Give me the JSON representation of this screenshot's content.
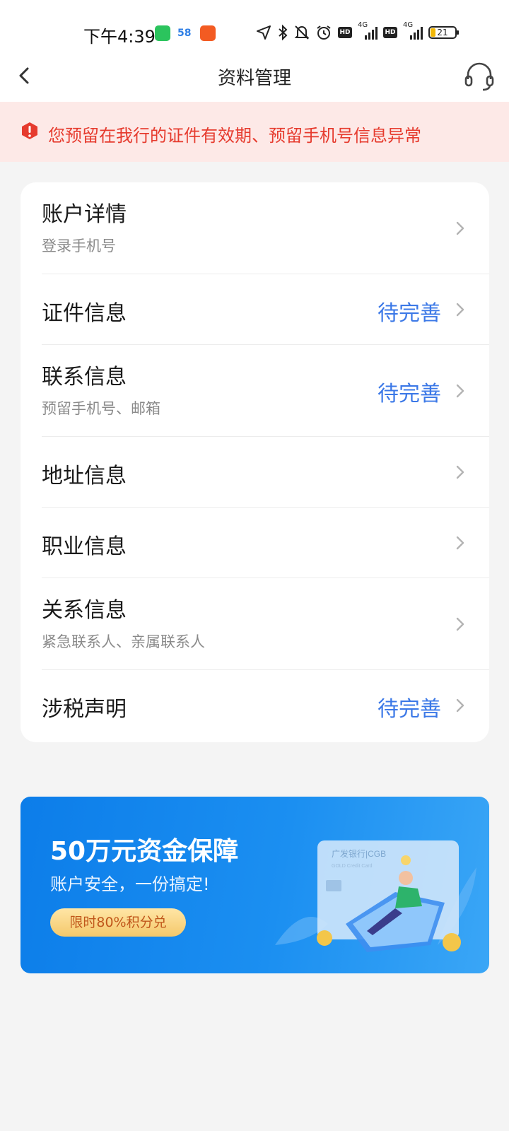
{
  "status_bar": {
    "time": "下午4:39",
    "net1": "4G",
    "net2": "4G",
    "hd": "HD",
    "battery": "21",
    "app_58": "58"
  },
  "nav": {
    "title": "资料管理",
    "back_icon": "chevron-left-icon",
    "support_icon": "headset-icon"
  },
  "alert": {
    "text": "您预留在我行的证件有效期、预留手机号信息异常",
    "icon": "exclamation-shield-icon",
    "color": "#e63b2e",
    "bg": "#fde9e7"
  },
  "profile_items": [
    {
      "title": "账户详情",
      "subtitle": "登录手机号",
      "status": ""
    },
    {
      "title": "证件信息",
      "subtitle": "",
      "status": "待完善"
    },
    {
      "title": "联系信息",
      "subtitle": "预留手机号、邮箱",
      "status": "待完善"
    },
    {
      "title": "地址信息",
      "subtitle": "",
      "status": ""
    },
    {
      "title": "职业信息",
      "subtitle": "",
      "status": ""
    },
    {
      "title": "关系信息",
      "subtitle": "紧急联系人、亲属联系人",
      "status": ""
    },
    {
      "title": "涉税声明",
      "subtitle": "",
      "status": "待完善"
    }
  ],
  "status_color": "#3b78e7",
  "banner": {
    "title": "50万元资金保障",
    "subtitle": "账户安全，一份搞定!",
    "button": "限时80%积分兑",
    "card_brand": "广发银行|CGB",
    "card_sub": "GOLD Credit Card"
  }
}
